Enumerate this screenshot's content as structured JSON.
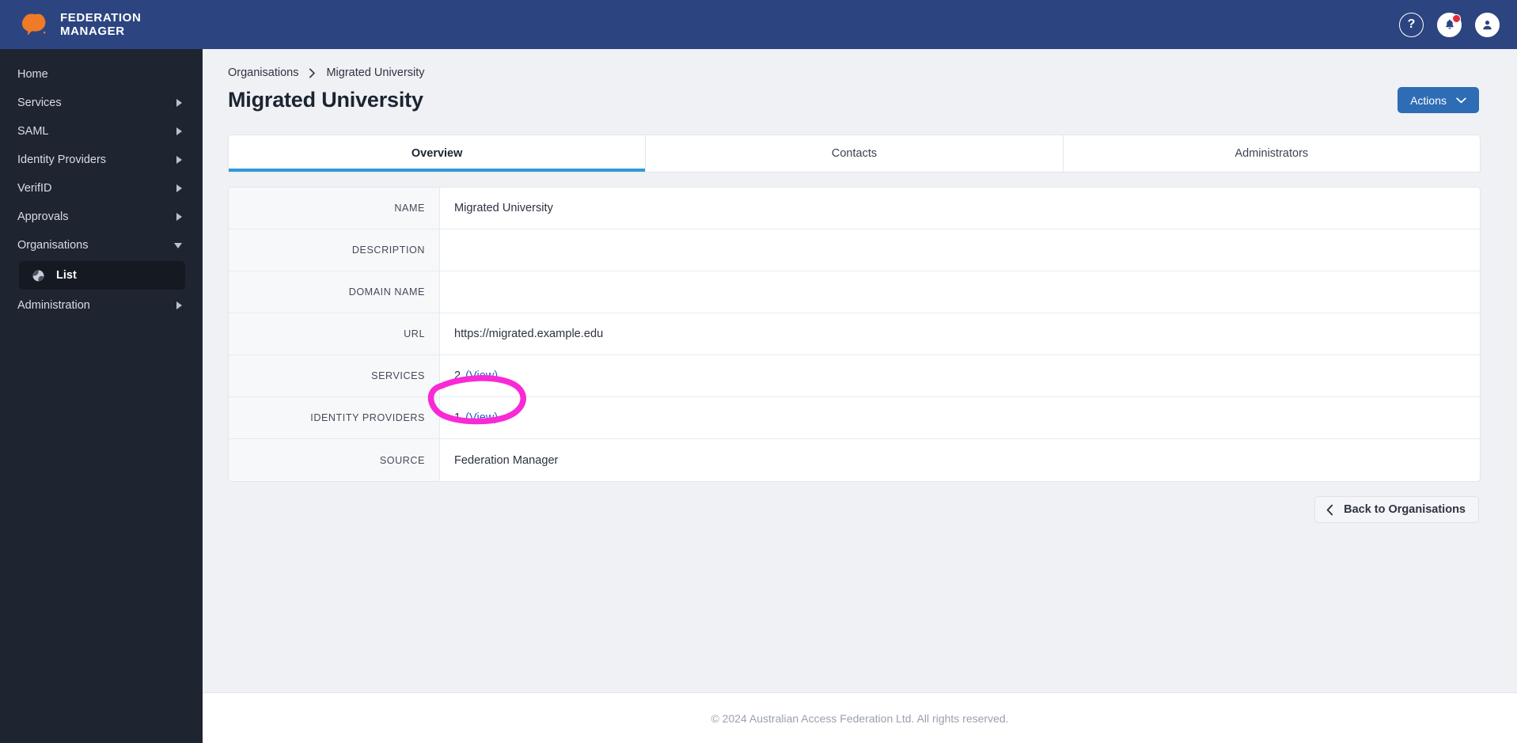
{
  "header": {
    "brand_line1": "FEDERATION",
    "brand_line2": "MANAGER",
    "help_label": "?",
    "icons": {
      "help": "help-circle-icon",
      "notifications": "bell-icon",
      "account": "user-avatar-icon"
    }
  },
  "sidebar": {
    "items": [
      {
        "label": "Home",
        "expandable": false
      },
      {
        "label": "Services",
        "expandable": true
      },
      {
        "label": "SAML",
        "expandable": true
      },
      {
        "label": "Identity Providers",
        "expandable": true
      },
      {
        "label": "VerifID",
        "expandable": true
      },
      {
        "label": "Approvals",
        "expandable": true
      },
      {
        "label": "Organisations",
        "expandable": true,
        "expanded": true
      },
      {
        "label": "Administration",
        "expandable": true
      }
    ],
    "organisations_sub": [
      {
        "label": "List",
        "icon": "globe-icon",
        "active": true
      }
    ]
  },
  "breadcrumb": {
    "root": "Organisations",
    "separator": "chevron-right-icon",
    "current": "Migrated University"
  },
  "page": {
    "title": "Migrated University",
    "actions_button": "Actions",
    "back_button": "Back to Organisations"
  },
  "tabs": [
    {
      "label": "Overview",
      "active": true
    },
    {
      "label": "Contacts",
      "active": false
    },
    {
      "label": "Administrators",
      "active": false
    }
  ],
  "details": [
    {
      "label": "NAME",
      "value": "Migrated University",
      "type": "text"
    },
    {
      "label": "DESCRIPTION",
      "value": "",
      "type": "text"
    },
    {
      "label": "DOMAIN NAME",
      "value": "",
      "type": "text"
    },
    {
      "label": "URL",
      "value": "https://migrated.example.edu",
      "type": "text"
    },
    {
      "label": "SERVICES",
      "value": "2",
      "link": "(View)",
      "type": "count-link",
      "highlighted": true
    },
    {
      "label": "IDENTITY PROVIDERS",
      "value": "1",
      "link": "(View)",
      "type": "count-link"
    },
    {
      "label": "SOURCE",
      "value": "Federation Manager",
      "type": "text"
    }
  ],
  "footer": {
    "copyright": "© 2024 Australian Access Federation Ltd. All rights reserved."
  },
  "annotation": {
    "shape": "hand-drawn-ellipse",
    "color": "#f929d6",
    "target": "SERVICES value 2 (View)"
  },
  "colors": {
    "header_blue": "#2c4580",
    "sidebar_dark": "#1e2430",
    "accent_blue": "#2e6cb5",
    "tab_underline": "#2e9bd6",
    "link_blue": "#2a5fc4",
    "logo_orange": "#f07b26",
    "badge_red": "#e8283c",
    "annotation_pink": "#f929d6"
  }
}
